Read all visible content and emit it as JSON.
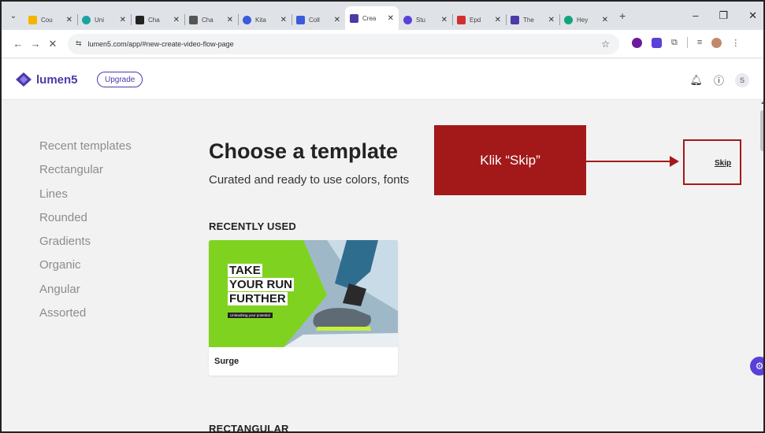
{
  "browser": {
    "tabs": [
      {
        "label": "Cou",
        "favicon_color": "#f4b400",
        "active": false
      },
      {
        "label": "Uni",
        "favicon_color": "#1aa3a3",
        "active": false
      },
      {
        "label": "Cha",
        "favicon_color": "#222222",
        "active": false
      },
      {
        "label": "Cha",
        "favicon_color": "#555555",
        "active": false
      },
      {
        "label": "Kita",
        "favicon_color": "#3b5bdb",
        "active": false
      },
      {
        "label": "Coll",
        "favicon_color": "#3b5bdb",
        "active": false
      },
      {
        "label": "Crea",
        "favicon_color": "#4b3aa8",
        "active": true
      },
      {
        "label": "Stu",
        "favicon_color": "#5b3fd9",
        "active": false
      },
      {
        "label": "Epd",
        "favicon_color": "#d32f2f",
        "active": false
      },
      {
        "label": "The",
        "favicon_color": "#4b3aa8",
        "active": false
      },
      {
        "label": "Hey",
        "favicon_color": "#12a37f",
        "active": false
      }
    ],
    "url": "lumen5.com/app/#new-create-video-flow-page"
  },
  "app": {
    "logo_text": "lumen5",
    "upgrade_label": "Upgrade",
    "avatar_initial": "S",
    "brand_color": "#4b3aa8"
  },
  "sidebar": {
    "categories": [
      "Recent templates",
      "Rectangular",
      "Lines",
      "Rounded",
      "Gradients",
      "Organic",
      "Angular",
      "Assorted"
    ]
  },
  "main": {
    "title": "Choose a template",
    "subtitle": "Curated and ready to use colors, fonts",
    "recent_heading": "RECENTLY USED",
    "rect_heading": "RECTANGULAR",
    "skip_label": "Skip",
    "card": {
      "name": "Surge",
      "thumb_lines": [
        "TAKE",
        "YOUR RUN",
        "FURTHER"
      ],
      "thumb_tag": "Unleashing your potential"
    }
  },
  "annotation": {
    "text": "Klik “Skip”",
    "color": "#a3191a"
  }
}
